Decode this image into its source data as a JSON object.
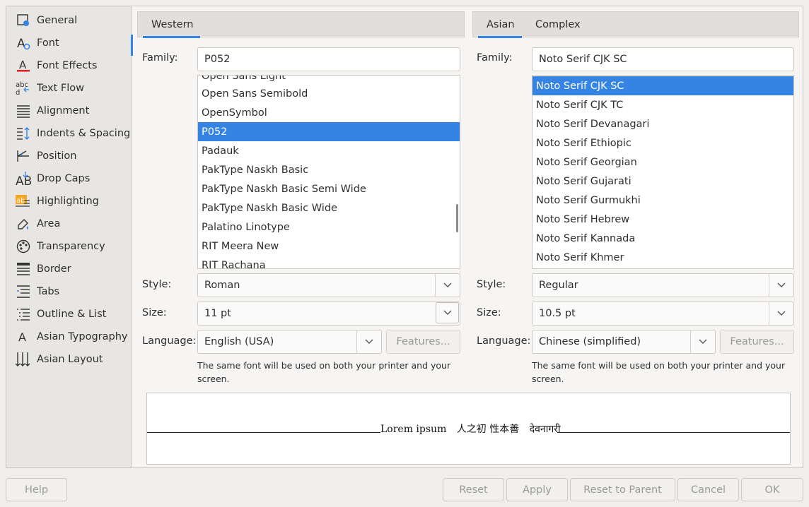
{
  "sidebar": {
    "items": [
      {
        "label": "General",
        "icon": "general-icon"
      },
      {
        "label": "Font",
        "icon": "font-icon"
      },
      {
        "label": "Font Effects",
        "icon": "font-effects-icon"
      },
      {
        "label": "Text Flow",
        "icon": "text-flow-icon"
      },
      {
        "label": "Alignment",
        "icon": "alignment-icon"
      },
      {
        "label": "Indents & Spacing",
        "icon": "indents-spacing-icon"
      },
      {
        "label": "Position",
        "icon": "position-icon"
      },
      {
        "label": "Drop Caps",
        "icon": "drop-caps-icon"
      },
      {
        "label": "Highlighting",
        "icon": "highlighting-icon"
      },
      {
        "label": "Area",
        "icon": "area-icon"
      },
      {
        "label": "Transparency",
        "icon": "transparency-icon"
      },
      {
        "label": "Border",
        "icon": "border-icon"
      },
      {
        "label": "Tabs",
        "icon": "tabs-icon"
      },
      {
        "label": "Outline & List",
        "icon": "outline-list-icon"
      },
      {
        "label": "Asian Typography",
        "icon": "asian-typography-icon"
      },
      {
        "label": "Asian Layout",
        "icon": "asian-layout-icon"
      }
    ],
    "selected": "Font"
  },
  "western": {
    "tab": "Western",
    "family_label": "Family:",
    "family_value": "P052",
    "fonts": [
      "Open Sans Light",
      "Open Sans Semibold",
      "OpenSymbol",
      "P052",
      "Padauk",
      "PakType Naskh Basic",
      "PakType Naskh Basic Semi Wide",
      "PakType Naskh Basic Wide",
      "Palatino Linotype",
      "RIT Meera New",
      "RIT Rachana"
    ],
    "selected_font": "P052",
    "style_label": "Style:",
    "style_value": "Roman",
    "size_label": "Size:",
    "size_value": "11 pt",
    "language_label": "Language:",
    "language_value": "English (USA)",
    "features_label": "Features...",
    "note": "The same font will be used on both your printer and your screen."
  },
  "asian": {
    "tabs": [
      "Asian",
      "Complex"
    ],
    "family_label": "Family:",
    "family_value": "Noto Serif CJK SC",
    "fonts": [
      "Noto Serif CJK SC",
      "Noto Serif CJK TC",
      "Noto Serif Devanagari",
      "Noto Serif Ethiopic",
      "Noto Serif Georgian",
      "Noto Serif Gujarati",
      "Noto Serif Gurmukhi",
      "Noto Serif Hebrew",
      "Noto Serif Kannada",
      "Noto Serif Khmer"
    ],
    "selected_font": "Noto Serif CJK SC",
    "style_label": "Style:",
    "style_value": "Regular",
    "size_label": "Size:",
    "size_value": "10.5 pt",
    "language_label": "Language:",
    "language_value": "Chinese (simplified)",
    "features_label": "Features...",
    "note": "The same font will be used on both your printer and your screen."
  },
  "preview": {
    "latin": "Lorem ipsum",
    "cjk": "人之初 性本善",
    "complex": "देवनागरी"
  },
  "buttons": {
    "help": "Help",
    "reset": "Reset",
    "apply": "Apply",
    "reset_parent": "Reset to Parent",
    "cancel": "Cancel",
    "ok": "OK"
  },
  "colors": {
    "accent": "#3584e4",
    "sidebar_bg": "#e8e6e3",
    "font_effects_red": "#e01b24",
    "highlight_orange": "#f5a623"
  }
}
